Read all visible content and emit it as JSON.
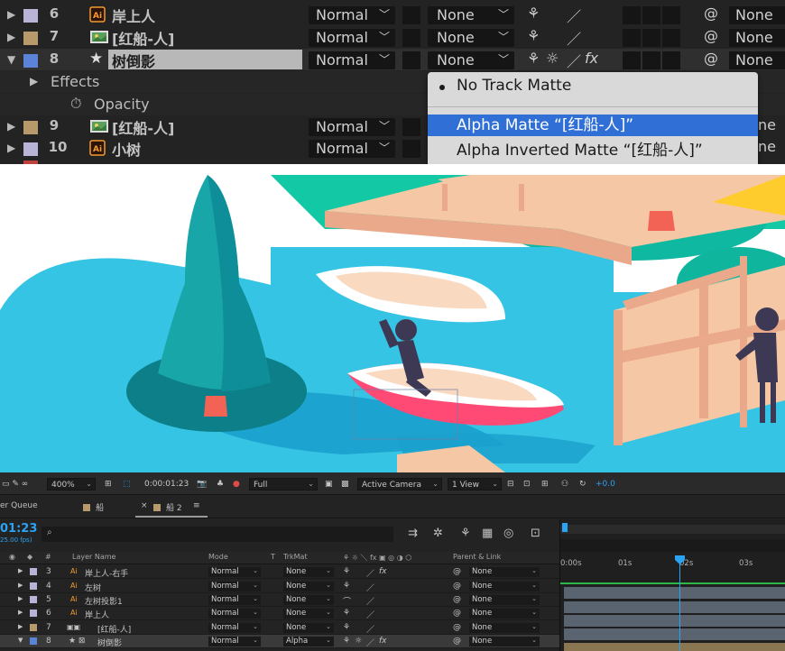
{
  "top_panel": {
    "rows": [
      {
        "num": "6",
        "name": "岸上人",
        "mode": "Normal",
        "trkmat": "None",
        "parent": "None",
        "swatch": "#b7b4d8",
        "icon": "illustrator-icon"
      },
      {
        "num": "7",
        "name": "[红船-人]",
        "mode": "Normal",
        "trkmat": "None",
        "parent": "None",
        "swatch": "#b69a6b",
        "icon": "precomp-icon"
      },
      {
        "num": "8",
        "name": "树倒影",
        "mode": "Normal",
        "trkmat": "None",
        "parent": "None",
        "swatch": "#5b83d8",
        "icon": "shape-star-icon",
        "fx": "fx"
      },
      {
        "num": "9",
        "name": "[红船-人]",
        "mode": "Normal",
        "trkmat": "",
        "parent": "None",
        "swatch": "#b69a6b",
        "icon": "precomp-icon"
      },
      {
        "num": "10",
        "name": "小树",
        "mode": "Normal",
        "trkmat": "",
        "parent": "None",
        "swatch": "#b7b4d8",
        "icon": "illustrator-icon"
      }
    ],
    "effects_label": "Effects",
    "opacity_label": "Opacity",
    "partial_parent": [
      "ne",
      "ne"
    ]
  },
  "dropdown": {
    "items": [
      "No Track Matte",
      "Alpha Matte “[红船-人]”",
      "Alpha Inverted Matte “[红船-人]”"
    ],
    "highlight_index": 1
  },
  "viewer_bar": {
    "zoom": "400%",
    "timecode": "0:00:01:23",
    "resolution": "Full",
    "camera": "Active Camera",
    "view": "1 View",
    "exposure": "+0.0"
  },
  "tabs": {
    "render_queue": "er Queue",
    "tab1": "船",
    "tab2": "船 2",
    "close": "×",
    "menu": "≡"
  },
  "controls": {
    "timecode": "01:23",
    "fps": "25.00 fps)",
    "search_icon": "⌕"
  },
  "column_headers": {
    "num": "#",
    "layer_name": "Layer Name",
    "mode": "Mode",
    "t": "T",
    "trkmat": "TrkMat",
    "parent": "Parent & Link"
  },
  "ruler": [
    "0:00s",
    "01s",
    "02s",
    "03s"
  ],
  "layers": [
    {
      "num": "3",
      "name": "岸上人-右手",
      "mode": "Normal",
      "trkmat": "None",
      "parent": "None",
      "swatch": "#b7b4d8",
      "fx": "fx"
    },
    {
      "num": "4",
      "name": "左树",
      "mode": "Normal",
      "trkmat": "None",
      "parent": "None",
      "swatch": "#b7b4d8",
      "fx": ""
    },
    {
      "num": "5",
      "name": "左树投影1",
      "mode": "Normal",
      "trkmat": "None",
      "parent": "None",
      "swatch": "#b7b4d8",
      "fx": ""
    },
    {
      "num": "6",
      "name": "岸上人",
      "mode": "Normal",
      "trkmat": "None",
      "parent": "None",
      "swatch": "#b7b4d8",
      "fx": ""
    },
    {
      "num": "7",
      "name": "[红船-人]",
      "mode": "Normal",
      "trkmat": "None",
      "parent": "None",
      "swatch": "#b69a6b",
      "fx": ""
    },
    {
      "num": "8",
      "name": "树倒影",
      "mode": "Normal",
      "trkmat": "Alpha",
      "parent": "None",
      "swatch": "#5b83d8",
      "fx": "fx"
    }
  ],
  "colors": {
    "accent": "#2aa3f5",
    "highlight": "#2f6fd6",
    "panel": "#232323",
    "water": "#35c4e4",
    "pier": "#f6c7a4",
    "tree": "#18a6a8"
  }
}
